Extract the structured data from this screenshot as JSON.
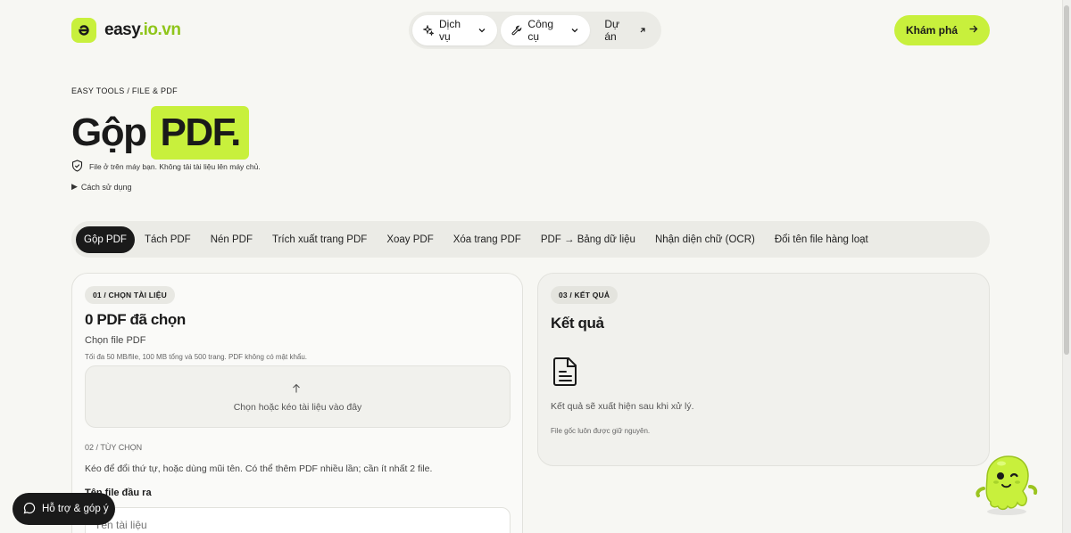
{
  "header": {
    "logo_text": "easy",
    "logo_accent": ".io.vn",
    "nav": [
      {
        "label": "Dịch vụ",
        "icon": "sparkle-icon",
        "has_dropdown": true
      },
      {
        "label": "Công cụ",
        "icon": "wrench-icon",
        "has_dropdown": true
      },
      {
        "label": "Dự án",
        "icon": "arrow-up-right-icon",
        "has_dropdown": false
      }
    ],
    "cta_label": "Khám phá"
  },
  "hero": {
    "breadcrumb": "EASY TOOLS / FILE & PDF",
    "title_plain": "Gộp",
    "title_highlight": "PDF.",
    "privacy_note": "File ở trên máy bạn. Không tải tài liệu lên máy chủ.",
    "howto": "Cách sử dụng"
  },
  "tabs": [
    {
      "label": "Gộp PDF",
      "active": true
    },
    {
      "label": "Tách PDF"
    },
    {
      "label": "Nén PDF"
    },
    {
      "label": "Trích xuất trang PDF"
    },
    {
      "label": "Xoay PDF"
    },
    {
      "label": "Xóa trang PDF"
    },
    {
      "label": "PDF → Bảng dữ liệu"
    },
    {
      "label": "Nhận diện chữ (OCR)"
    },
    {
      "label": "Đổi tên file hàng loạt"
    }
  ],
  "left_panel": {
    "badge": "01 / CHỌN TÀI LIỆU",
    "heading": "0 PDF đã chọn",
    "choose_label": "Chọn file PDF",
    "limits": "Tối đa 50 MB/file, 100 MB tổng và 500 trang. PDF không có mật khẩu.",
    "dropzone_text": "Chọn hoặc kéo tài liệu vào đây",
    "options_label": "02 / TÙY CHỌN",
    "instructions": "Kéo để đổi thứ tự, hoặc dùng mũi tên. Có thể thêm PDF nhiều lần; cần ít nhất 2 file.",
    "output_label": "Tên file đầu ra",
    "output_placeholder": "Tên tài liệu"
  },
  "right_panel": {
    "badge": "03 / KẾT QUẢ",
    "heading": "Kết quả",
    "result_note": "Kết quả sẽ xuất hiện sau khi xử lý.",
    "original_note": "File gốc luôn được giữ nguyên."
  },
  "support_label": "Hỗ trợ & góp ý",
  "colors": {
    "accent": "#c8f03c",
    "dark": "#1a1a1a",
    "background": "#f7f7f3"
  }
}
